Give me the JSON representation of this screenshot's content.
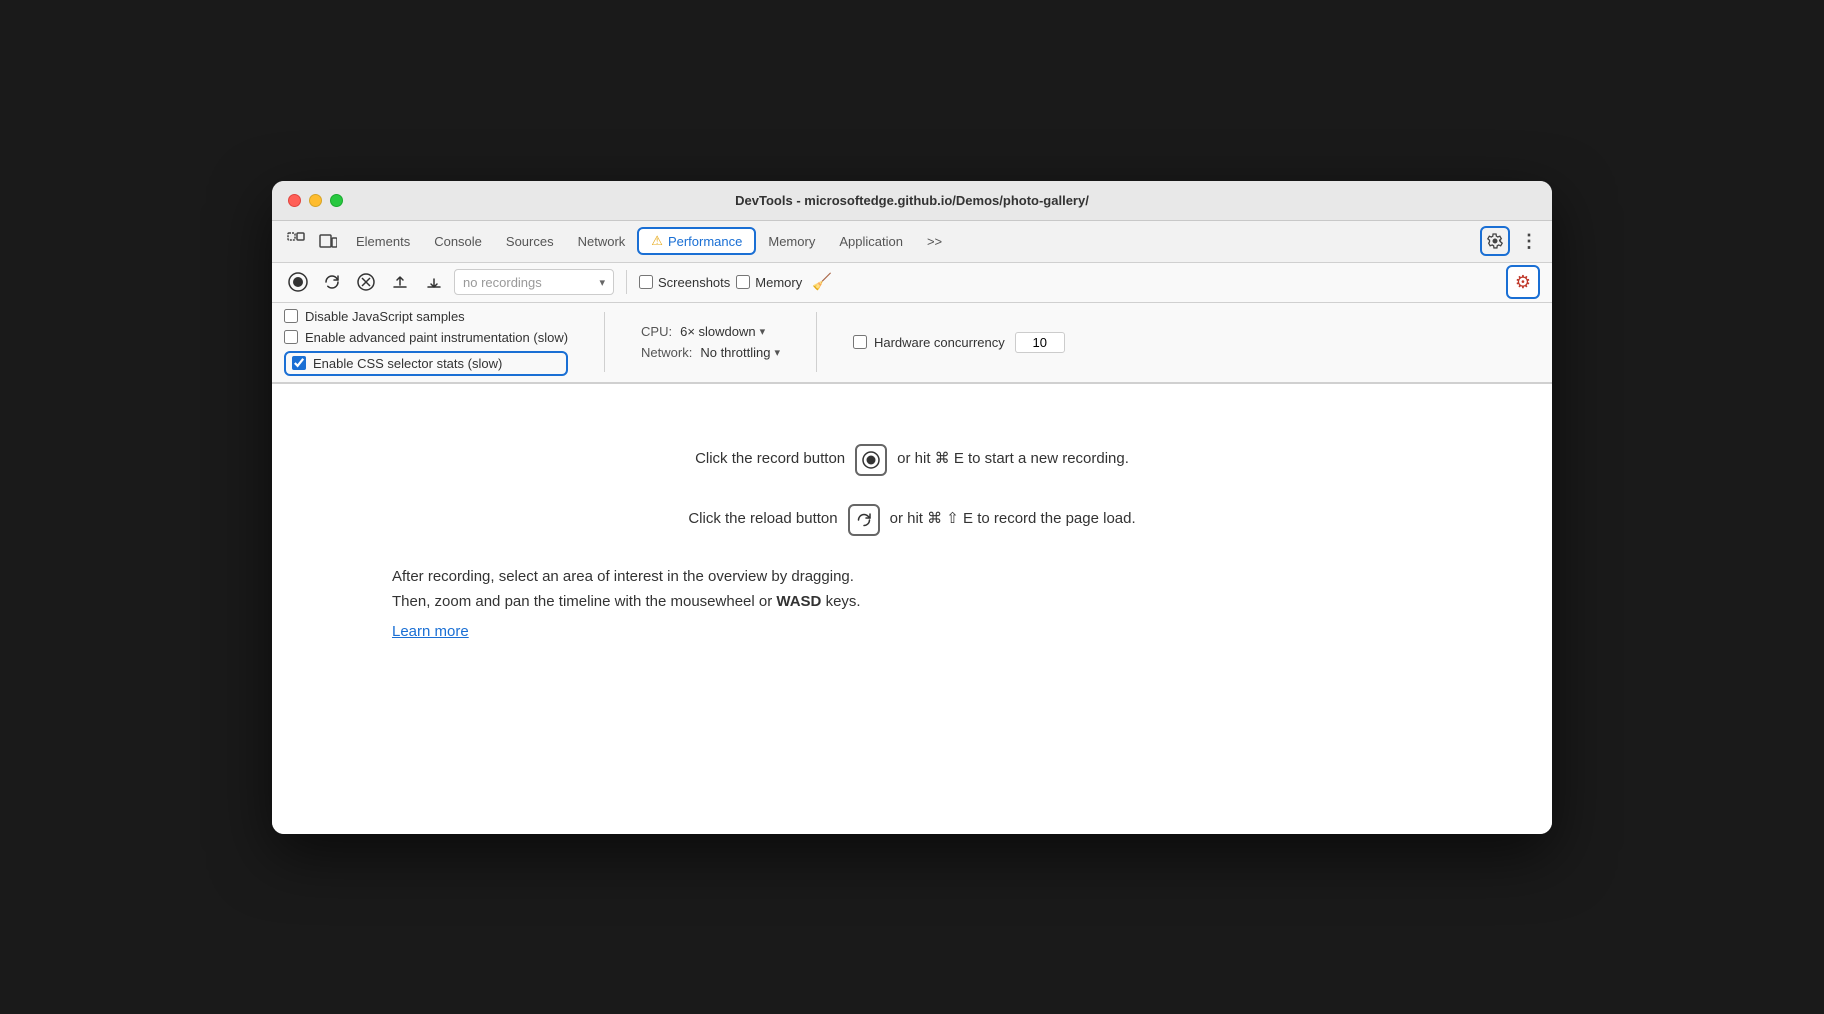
{
  "window": {
    "title": "DevTools - microsoftedge.github.io/Demos/photo-gallery/"
  },
  "tabs": {
    "items": [
      {
        "label": "Elements",
        "active": false
      },
      {
        "label": "Console",
        "active": false
      },
      {
        "label": "Sources",
        "active": false
      },
      {
        "label": "Network",
        "active": false
      },
      {
        "label": "Performance",
        "active": true,
        "warn": true
      },
      {
        "label": "Memory",
        "active": false
      },
      {
        "label": "Application",
        "active": false
      }
    ],
    "more_label": ">>"
  },
  "secondary_toolbar": {
    "no_recordings_placeholder": "no recordings",
    "screenshots_label": "Screenshots",
    "memory_label": "Memory"
  },
  "options": {
    "disable_js_samples": "Disable JavaScript samples",
    "enable_paint": "Enable advanced paint instrumentation (slow)",
    "enable_css": "Enable CSS selector stats (slow)",
    "cpu_label": "CPU:",
    "cpu_value": "6× slowdown",
    "network_label": "Network:",
    "network_value": "No throttling",
    "hardware_label": "Hardware concurrency",
    "hardware_value": "10"
  },
  "instructions": {
    "line1_before": "Click the record button",
    "line1_after": "or hit ⌘ E to start a new recording.",
    "line2_before": "Click the reload button",
    "line2_after": "or hit ⌘ ⇧ E to record the page load.",
    "line3": "After recording, select an area of interest in the overview by dragging.",
    "line4": "Then, zoom and pan the timeline with the mousewheel or",
    "line4_bold": "WASD",
    "line4_after": "keys.",
    "learn_more": "Learn more"
  }
}
